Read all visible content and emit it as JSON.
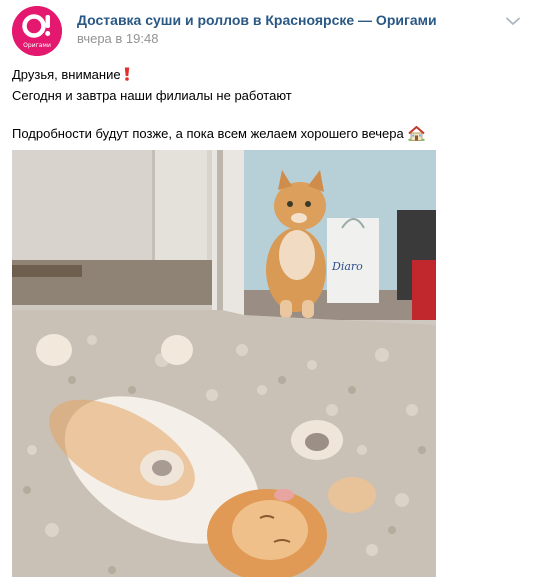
{
  "community": {
    "name": "Доставка суши и роллов в Красноярске — Оригами",
    "avatar_label": "Оригами",
    "brand_color": "#e4186e"
  },
  "post": {
    "time": "вчера в 19:48",
    "lines": {
      "first": "Друзья, внимание",
      "second": "Сегодня и завтра наши филиалы не работают",
      "third": "Подробности будут позже, а пока всем желаем хорошего вечера"
    },
    "emoji": [
      "exclamation-mark-icon",
      "house-icon"
    ],
    "photo_icon": "cats-photo"
  },
  "icons": {
    "menu": "chevron-down-icon"
  },
  "colors": {
    "link": "#2a5885",
    "meta": "#939393",
    "text": "#000000"
  }
}
